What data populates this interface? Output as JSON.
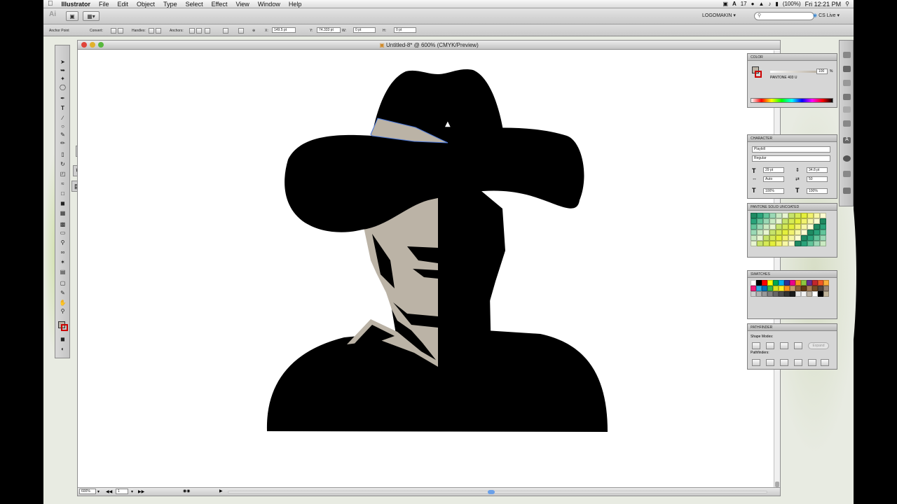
{
  "menubar": {
    "app": "Illustrator",
    "items": [
      "File",
      "Edit",
      "Object",
      "Type",
      "Select",
      "Effect",
      "View",
      "Window",
      "Help"
    ],
    "status_badge": "17",
    "battery": "(100%)",
    "clock": "Fri 12:21 PM"
  },
  "appbar": {
    "workspace": "LOGOMAKIN",
    "cs_live": "CS Live"
  },
  "control": {
    "anchor_point_label": "Anchor Point",
    "convert_label": "Convert:",
    "handles_label": "Handles:",
    "anchors_label": "Anchors:",
    "x_label": "X:",
    "x_value": "149.5 pt",
    "y_label": "Y:",
    "y_value": "74.333 pt",
    "w_label": "W:",
    "w_value": "0 pt",
    "h_label": "H:",
    "h_value": "0 pt"
  },
  "document": {
    "title": "Untitled-8* @ 600% (CMYK/Preview)",
    "zoom": "600%",
    "artboard": "1"
  },
  "panels": {
    "color": {
      "title": "COLOR",
      "swatch_name": "PANTONE 403 U",
      "tint_value": "100",
      "tint_unit": "%"
    },
    "character": {
      "title": "CHARACTER",
      "font_family": "Playbill",
      "font_style": "Regular",
      "font_size": "29 pt",
      "leading": "34.8 pt",
      "kerning": "Auto",
      "tracking": "50",
      "vertical_scale": "100%",
      "horizontal_scale": "100%"
    },
    "pantone": {
      "title": "PANTONE SOLID UNCOATED"
    },
    "swatches": {
      "title": "SWATCHES"
    },
    "pathfinder": {
      "title": "PATHFINDER",
      "shape_modes": "Shape Modes:",
      "expand": "Expand",
      "pathfinders": "Pathfinders:"
    }
  },
  "colors": {
    "face": "#bbb3a6",
    "ink": "#000000",
    "selection": "#4a76d6"
  },
  "icons": [
    "apple-icon",
    "search-icon",
    "gear-icon",
    "close-icon",
    "arrow-icon",
    "pen-icon",
    "type-icon",
    "brush-icon",
    "scissors-icon"
  ]
}
